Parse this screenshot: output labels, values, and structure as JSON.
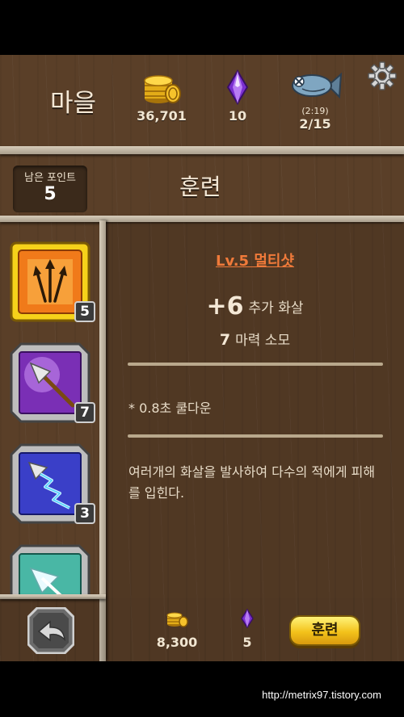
{
  "header": {
    "location_label": "마을",
    "gold": "36,701",
    "gems": "10",
    "fish_timer": "(2:19)",
    "fish": "2/15"
  },
  "points": {
    "label": "남은 포인트",
    "value": "5"
  },
  "title": "훈련",
  "skills": [
    {
      "badge": "5",
      "color": "#f07a1a"
    },
    {
      "badge": "7",
      "color": "#7a2fb5"
    },
    {
      "badge": "3",
      "color": "#3a3fc8"
    },
    {
      "badge": "",
      "color": "#49b7a5"
    }
  ],
  "detail": {
    "name": "Lv.5 멀티샷",
    "bonus_value": "+6",
    "bonus_label": "추가 화살",
    "mana_value": "7",
    "mana_label": "마력 소모",
    "cooldown": "* 0.8초 쿨다운",
    "description": "여러개의 화살을 발사하여 다수의 적에게 피해를 입힌다."
  },
  "bottom": {
    "cost_gold": "8,300",
    "cost_gems": "5",
    "train_button": "훈련"
  },
  "watermark": "http://metrix97.tistory.com"
}
